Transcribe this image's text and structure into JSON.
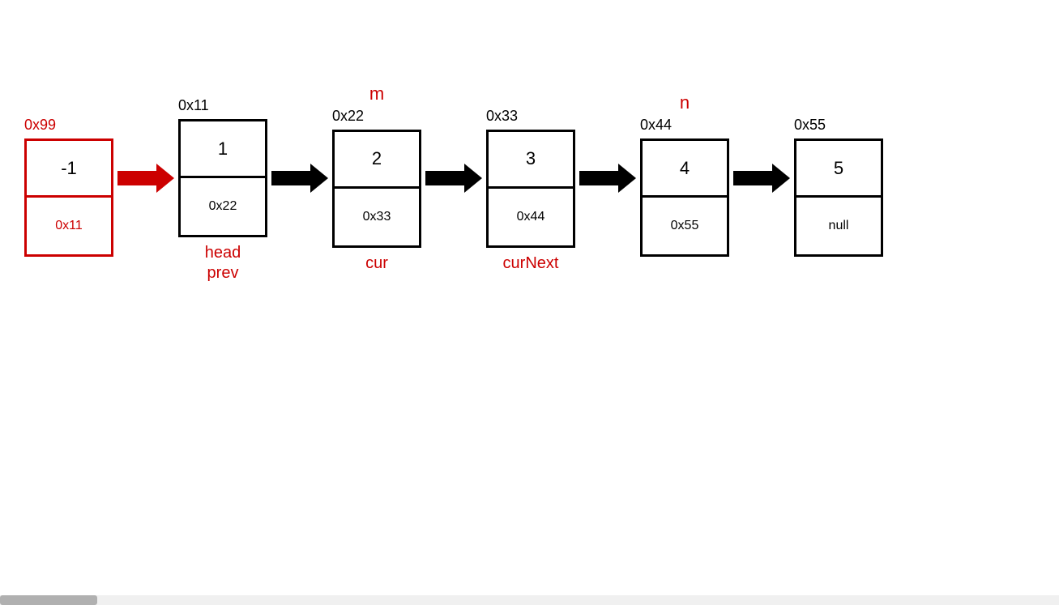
{
  "nodes": [
    {
      "id": "node-0x99",
      "addr": "0x99",
      "addrColor": "red",
      "val": "-1",
      "next": "0x11",
      "nextColor": "red",
      "borderColor": "red",
      "labelTop": null,
      "labelsBelow": []
    },
    {
      "id": "node-0x11",
      "addr": "0x11",
      "addrColor": "black",
      "val": "1",
      "next": "0x22",
      "nextColor": "black",
      "borderColor": "black",
      "labelTop": null,
      "labelsBelow": [
        "head",
        "prev"
      ]
    },
    {
      "id": "node-0x22",
      "addr": "0x22",
      "addrColor": "black",
      "val": "2",
      "next": "0x33",
      "nextColor": "black",
      "borderColor": "black",
      "labelTop": "m",
      "labelsBelow": [
        "cur"
      ]
    },
    {
      "id": "node-0x33",
      "addr": "0x33",
      "addrColor": "black",
      "val": "3",
      "next": "0x44",
      "nextColor": "black",
      "borderColor": "black",
      "labelTop": null,
      "labelsBelow": [
        "curNext"
      ]
    },
    {
      "id": "node-0x44",
      "addr": "0x44",
      "addrColor": "black",
      "val": "4",
      "next": "0x55",
      "nextColor": "black",
      "borderColor": "black",
      "labelTop": "n",
      "labelsBelow": []
    },
    {
      "id": "node-0x55",
      "addr": "0x55",
      "addrColor": "black",
      "val": "5",
      "next": "null",
      "nextColor": "black",
      "borderColor": "black",
      "labelTop": null,
      "labelsBelow": []
    }
  ],
  "arrows": [
    {
      "color": "red"
    },
    {
      "color": "black"
    },
    {
      "color": "black"
    },
    {
      "color": "black"
    },
    {
      "color": "black"
    }
  ]
}
